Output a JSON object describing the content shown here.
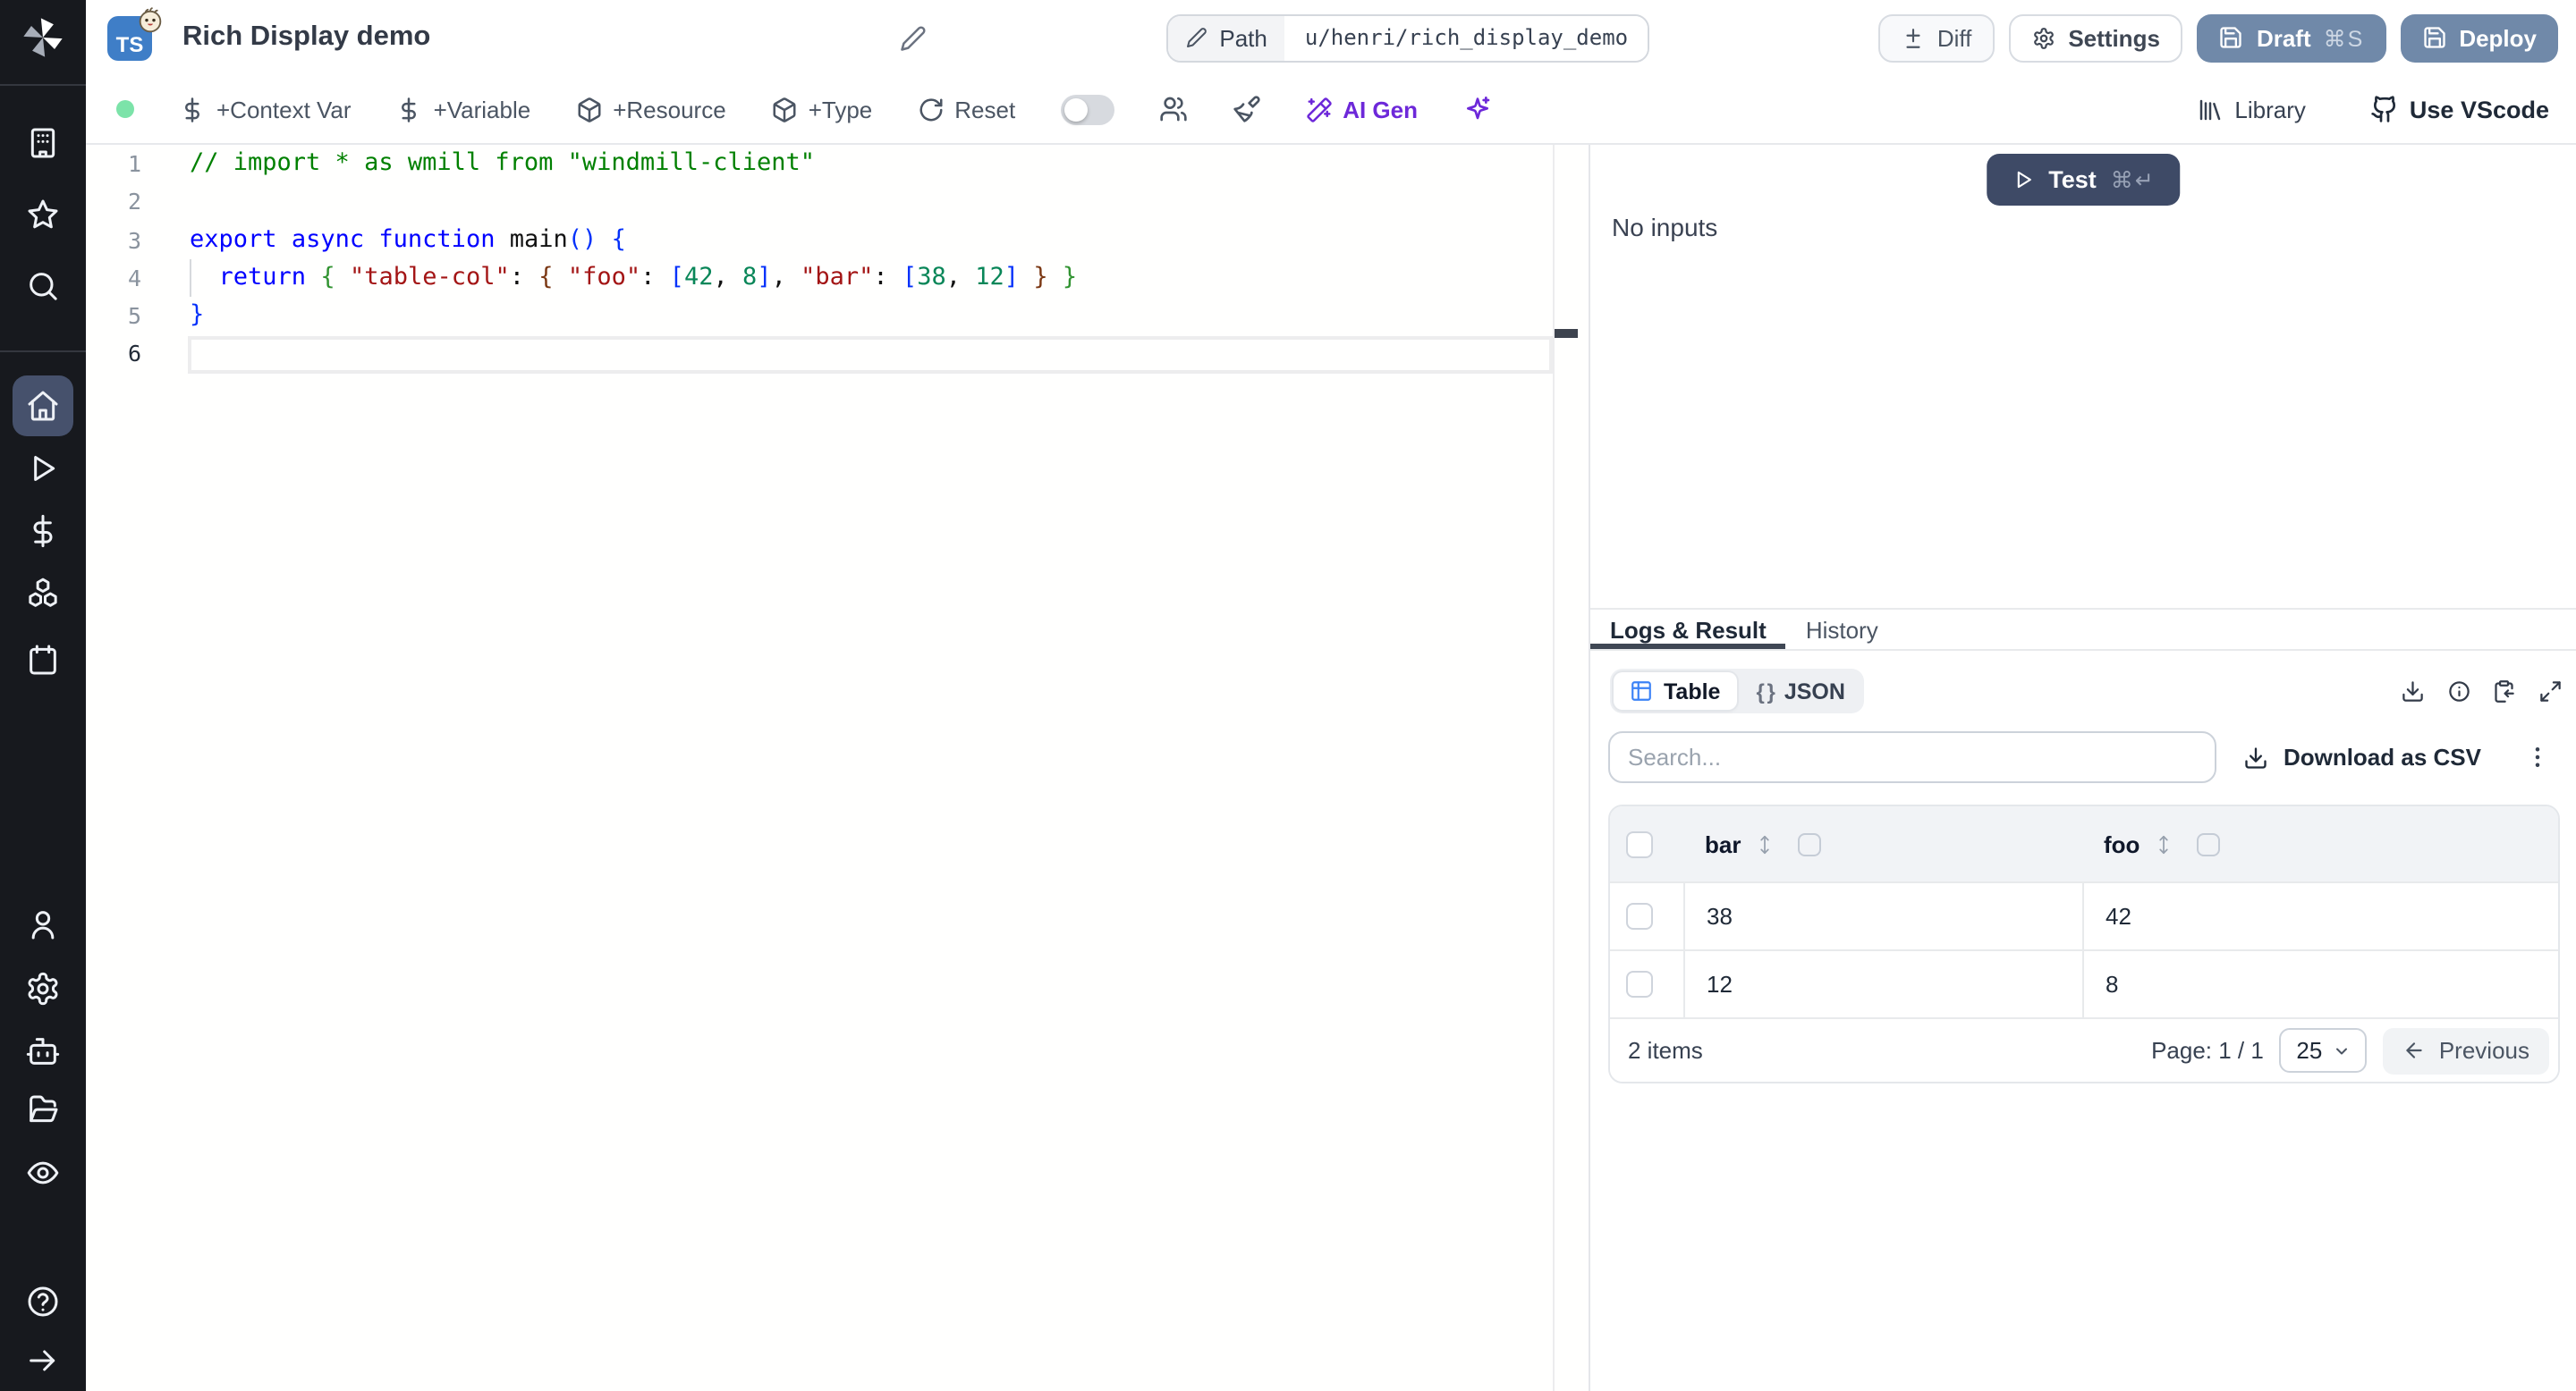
{
  "colors": {
    "accent_violet": "#6d28d9",
    "slate_button": "#7089a9",
    "dark_button": "#3e4a66",
    "status_green": "#7ce3a9",
    "active_sidebar": "#46516c",
    "ts_badge": "#3f7ec7"
  },
  "header": {
    "title": "Rich Display demo",
    "language_badge": "TS",
    "path_label": "Path",
    "path_value": "u/henri/rich_display_demo",
    "diff_label": "Diff",
    "settings_label": "Settings",
    "draft_label": "Draft",
    "draft_shortcut": "⌘S",
    "deploy_label": "Deploy"
  },
  "toolbar": {
    "context_var_label": "+Context Var",
    "variable_label": "+Variable",
    "resource_label": "+Resource",
    "type_label": "+Type",
    "reset_label": "Reset",
    "ai_gen_label": "AI Gen",
    "library_label": "Library",
    "vscode_label": "Use VScode"
  },
  "editor": {
    "active_line": 6,
    "lines": [
      {
        "n": 1,
        "tokens": [
          {
            "t": "// import * as wmill from \"windmill-client\"",
            "c": "comment"
          }
        ]
      },
      {
        "n": 2,
        "tokens": []
      },
      {
        "n": 3,
        "tokens": [
          {
            "t": "export",
            "c": "keyword"
          },
          {
            "t": " ",
            "c": "plain"
          },
          {
            "t": "async",
            "c": "keyword"
          },
          {
            "t": " ",
            "c": "plain"
          },
          {
            "t": "function",
            "c": "keyword"
          },
          {
            "t": " ",
            "c": "plain"
          },
          {
            "t": "main",
            "c": "plain"
          },
          {
            "t": "()",
            "c": "b1"
          },
          {
            "t": " ",
            "c": "plain"
          },
          {
            "t": "{",
            "c": "b1"
          }
        ]
      },
      {
        "n": 4,
        "tokens": [
          {
            "t": "  ",
            "c": "plain"
          },
          {
            "t": "return",
            "c": "keyword"
          },
          {
            "t": " ",
            "c": "plain"
          },
          {
            "t": "{",
            "c": "b2"
          },
          {
            "t": " ",
            "c": "plain"
          },
          {
            "t": "\"table-col\"",
            "c": "string"
          },
          {
            "t": ": ",
            "c": "plain"
          },
          {
            "t": "{",
            "c": "b3"
          },
          {
            "t": " ",
            "c": "plain"
          },
          {
            "t": "\"foo\"",
            "c": "string"
          },
          {
            "t": ": ",
            "c": "plain"
          },
          {
            "t": "[",
            "c": "b1"
          },
          {
            "t": "42",
            "c": "number"
          },
          {
            "t": ", ",
            "c": "plain"
          },
          {
            "t": "8",
            "c": "number"
          },
          {
            "t": "]",
            "c": "b1"
          },
          {
            "t": ", ",
            "c": "plain"
          },
          {
            "t": "\"bar\"",
            "c": "string"
          },
          {
            "t": ": ",
            "c": "plain"
          },
          {
            "t": "[",
            "c": "b1"
          },
          {
            "t": "38",
            "c": "number"
          },
          {
            "t": ", ",
            "c": "plain"
          },
          {
            "t": "12",
            "c": "number"
          },
          {
            "t": "]",
            "c": "b1"
          },
          {
            "t": " ",
            "c": "plain"
          },
          {
            "t": "}",
            "c": "b3"
          },
          {
            "t": " ",
            "c": "plain"
          },
          {
            "t": "}",
            "c": "b2"
          }
        ]
      },
      {
        "n": 5,
        "tokens": [
          {
            "t": "}",
            "c": "b1"
          }
        ]
      },
      {
        "n": 6,
        "tokens": []
      }
    ]
  },
  "run_panel": {
    "test_label": "Test",
    "test_shortcut": "⌘↵",
    "no_inputs_label": "No inputs"
  },
  "result_panel": {
    "tabs": {
      "logs": "Logs & Result",
      "history": "History"
    },
    "view_toggle": {
      "table": "Table",
      "json": "JSON",
      "json_glyph": "{ }"
    },
    "search_placeholder": "Search...",
    "download_csv": "Download as CSV",
    "table": {
      "columns": [
        "bar",
        "foo"
      ],
      "rows": [
        [
          "38",
          "42"
        ],
        [
          "12",
          "8"
        ]
      ]
    },
    "footer": {
      "count": "2 items",
      "page": "Page: 1 / 1",
      "page_size": "25",
      "previous": "Previous"
    }
  },
  "sidebar": {
    "icons": [
      "building",
      "star",
      "search",
      "home",
      "play",
      "dollar",
      "boxes",
      "calendar",
      "user",
      "settings",
      "bot",
      "folder-open",
      "eye",
      "help",
      "arrow-right"
    ],
    "active_icon": "home"
  }
}
